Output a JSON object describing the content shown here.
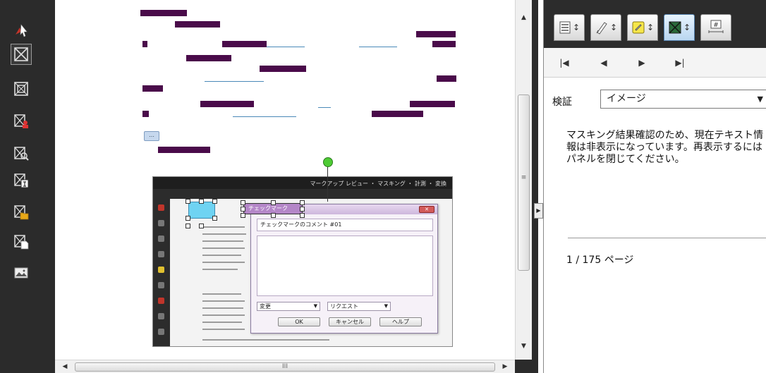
{
  "toolbar": {
    "tools": [
      {
        "name": "select-cursor-icon"
      },
      {
        "name": "mask-area-icon",
        "active": true
      },
      {
        "name": "mask-region-icon"
      },
      {
        "name": "mask-person-icon"
      },
      {
        "name": "mask-search-icon"
      },
      {
        "name": "mask-text-icon"
      },
      {
        "name": "mask-folder-icon"
      },
      {
        "name": "mask-page-icon"
      },
      {
        "name": "mask-image-icon"
      }
    ]
  },
  "embedded": {
    "menu_label": "マークアップ  レビュー ・ マスキング ・ 計測 ・ 変換",
    "shape_label": "チェックマーク",
    "dialog": {
      "comment_value": "チェックマークのコメント #01",
      "select1": "変更",
      "select2": "リクエスト",
      "ok": "OK",
      "cancel": "キャンセル",
      "help": "ヘルプ"
    }
  },
  "scrollbars": {
    "v_up": "▲",
    "v_down": "▼",
    "v_grip": "≡",
    "h_left": "◀",
    "h_right": "▶",
    "h_grip": "III"
  },
  "panel": {
    "collapse": "▶",
    "tabs": [
      {
        "icon": "list-icon",
        "active": false
      },
      {
        "icon": "pen-icon",
        "active": false
      },
      {
        "icon": "note-icon",
        "active": false
      },
      {
        "icon": "mask-tab-icon",
        "active": true
      },
      {
        "icon": "number-icon",
        "active": false
      }
    ],
    "nav": {
      "first": "|◀",
      "prev": "◀",
      "next": "▶",
      "last": "▶|"
    },
    "verify_label": "検証",
    "verify_value": "イメージ",
    "message": "マスキング結果確認のため、現在テキスト情報は非表示になっています。再表示するにはパネルを閉じてください。",
    "page_count": "1 / 175 ページ"
  },
  "colors": {
    "redaction": "#4a0b4a",
    "rail": "#2b2b2b",
    "accent": "#5582b0"
  }
}
